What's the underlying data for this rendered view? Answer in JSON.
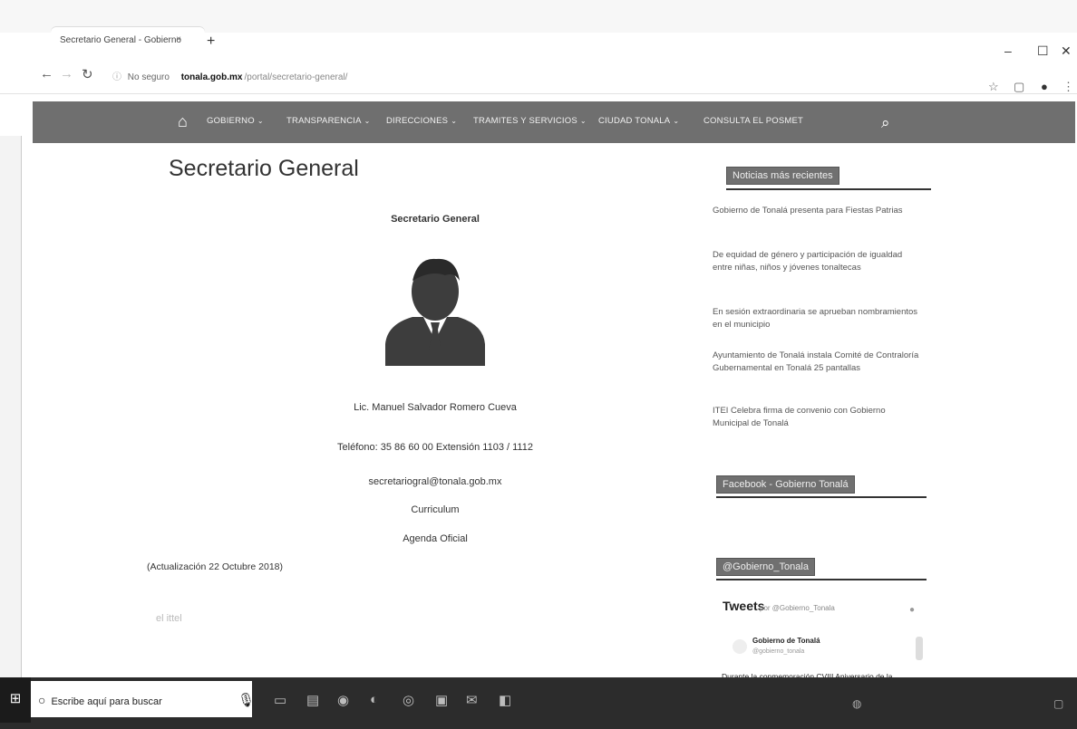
{
  "browser": {
    "tab_title": "Secretario General - Gobierno",
    "tab_close": "×",
    "new_tab": "+",
    "url_security": "No seguro",
    "url_host": "tonala.gob.mx",
    "url_path": "/portal/secretario-general/",
    "window_controls": [
      "–",
      "☐",
      "✕"
    ]
  },
  "navbar": {
    "items": [
      "GOBIERNO",
      "TRANSPARENCIA",
      "DIRECCIONES",
      "TRAMITES Y SERVICIOS",
      "CIUDAD TONALA",
      "CONSULTA EL POSMET"
    ],
    "caret": "⌄"
  },
  "main": {
    "title": "Secretario General",
    "subtitle": "Secretario General",
    "name": "Lic. Manuel Salvador Romero Cueva",
    "phone": "Teléfono: 35 86 60 00 Extensión 1103 / 1112",
    "email": "secretariogral@tonala.gob.mx",
    "curriculum": "Curriculum",
    "agenda": "Agenda Oficial",
    "update_note": "(Actualización 22 Octubre 2018)",
    "faint_text": "el                  ittel"
  },
  "sidebar": {
    "recent_heading": "Noticias más recientes",
    "news": [
      "Gobierno de Tonalá presenta para Fiestas Patrias",
      "De equidad de género y participación de igualdad entre niñas, niños y jóvenes tonaltecas",
      "En sesión extraordinaria se aprueban nombramientos en el municipio",
      "Ayuntamiento de Tonalá instala Comité de Contraloría Gubernamental en Tonalá 25 pantallas",
      "ITEI Celebra firma de convenio con Gobierno Municipal de Tonalá"
    ],
    "facebook_heading": "Facebook - Gobierno Tonalá",
    "twitter_heading": "@Gobierno_Tonala",
    "tweets_title": "Tweets",
    "tweets_by": "por @Gobierno_Tonala",
    "tweet_author": "Gobierno de Tonalá",
    "tweet_handle": "@gobierno_tonala",
    "tweet_text": "Durante la conmemoración CVIII Aniversario de la Revolución Mexicana, se recuerdan los ideales de"
  },
  "taskbar": {
    "search_placeholder": "Escribe aquí para buscar"
  }
}
